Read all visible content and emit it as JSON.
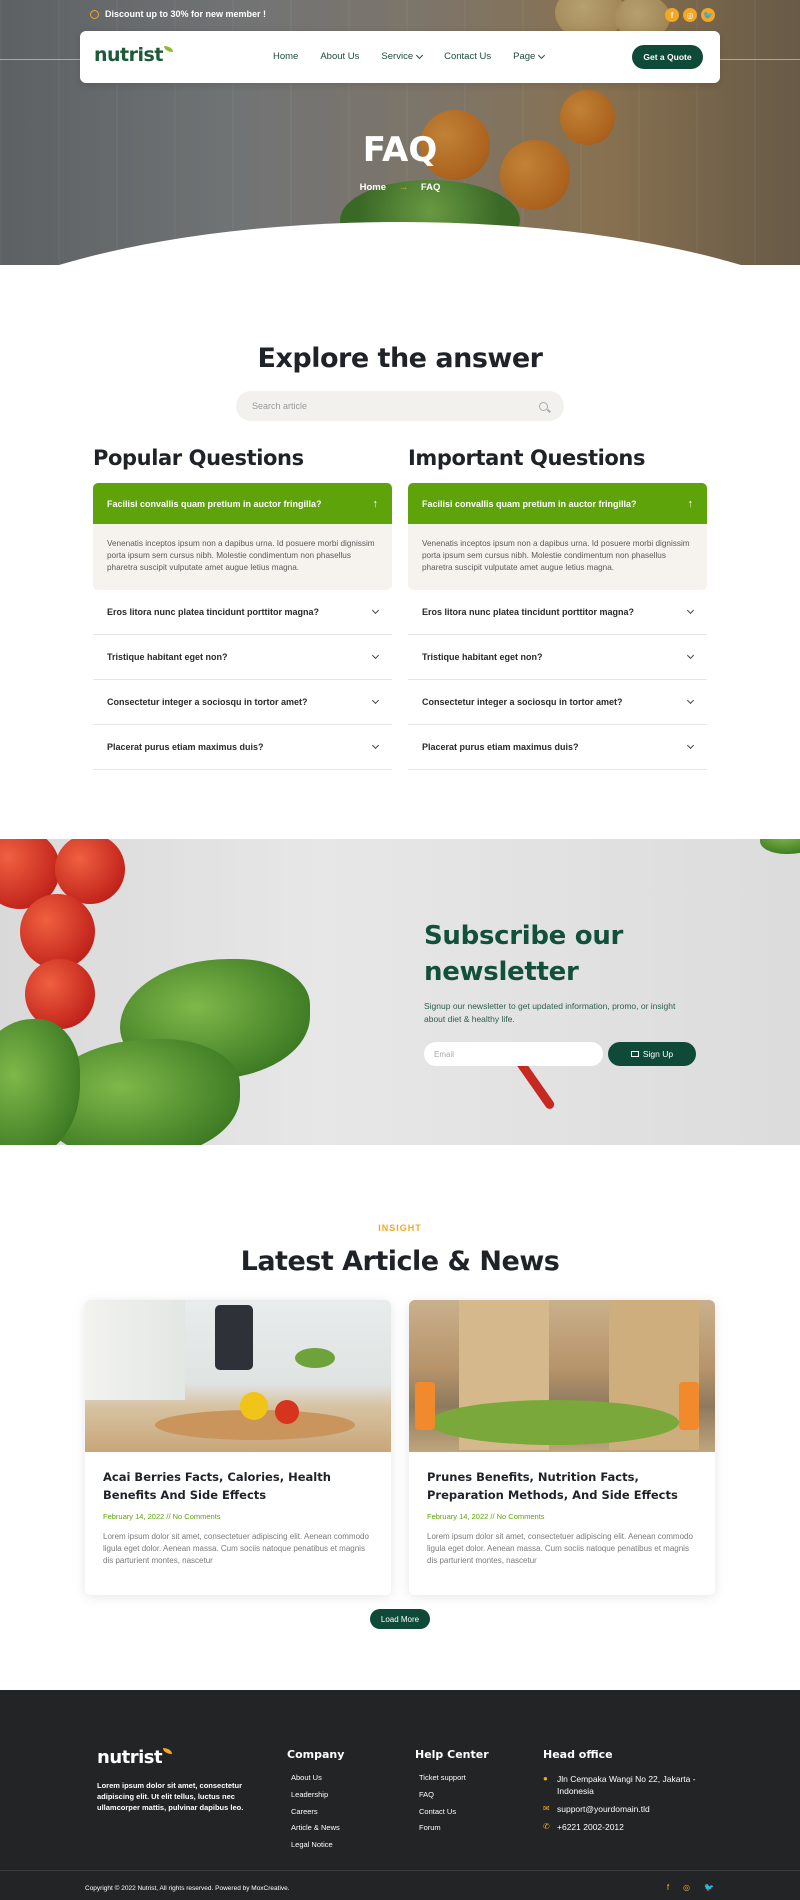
{
  "topbar": {
    "promo": "Discount up to 30% for new member !",
    "social": [
      "f",
      "◎",
      "🐦"
    ]
  },
  "nav": {
    "logo": "nutrist",
    "items": [
      {
        "label": "Home",
        "dropdown": false
      },
      {
        "label": "About Us",
        "dropdown": false
      },
      {
        "label": "Service",
        "dropdown": true
      },
      {
        "label": "Contact Us",
        "dropdown": false
      },
      {
        "label": "Page",
        "dropdown": true
      }
    ],
    "cta": "Get a Quote"
  },
  "hero": {
    "title": "FAQ",
    "breadcrumb_home": "Home",
    "breadcrumb_arrow": "→",
    "breadcrumb_current": "FAQ"
  },
  "faq": {
    "title": "Explore the answer",
    "search_placeholder": "Search article",
    "popular": {
      "heading": "Popular Questions",
      "active_question": "Facilisi convallis quam pretium in auctor fringilla?",
      "active_answer": "Venenatis inceptos ipsum non a dapibus urna. Id posuere morbi dignissim porta ipsum sem cursus nibh. Molestie condimentum non phasellus pharetra suscipit vulputate amet augue letius magna.",
      "questions": [
        "Eros litora nunc platea tincidunt porttitor magna?",
        "Tristique habitant eget non?",
        "Consectetur integer a sociosqu in tortor amet?",
        "Placerat purus etiam maximus duis?"
      ]
    },
    "important": {
      "heading": "Important Questions",
      "active_question": "Facilisi convallis quam pretium in auctor fringilla?",
      "active_answer": "Venenatis inceptos ipsum non a dapibus urna. Id posuere morbi dignissim porta ipsum sem cursus nibh. Molestie condimentum non phasellus pharetra suscipit vulputate amet augue letius magna.",
      "questions": [
        "Eros litora nunc platea tincidunt porttitor magna?",
        "Tristique habitant eget non?",
        "Consectetur integer a sociosqu in tortor amet?",
        "Placerat purus etiam maximus duis?"
      ]
    }
  },
  "newsletter": {
    "title": "Subscribe our newsletter",
    "subtitle": "Signup our newsletter to get updated information, promo, or insight about diet & healthy life.",
    "email_placeholder": "Email",
    "button": "Sign Up"
  },
  "articles": {
    "eyebrow": "INSIGHT",
    "title": "Latest Article & News",
    "items": [
      {
        "title": "Acai Berries Facts, Calories, Health Benefits And Side Effects",
        "meta": "February 14, 2022 // No Comments",
        "excerpt": "Lorem ipsum dolor sit amet, consectetuer adipiscing elit. Aenean commodo ligula eget dolor. Aenean massa. Cum sociis natoque penatibus et magnis dis parturient montes, nascetur"
      },
      {
        "title": "Prunes Benefits, Nutrition Facts, Preparation Methods, And Side Effects",
        "meta": "February 14, 2022 // No Comments",
        "excerpt": "Lorem ipsum dolor sit amet, consectetuer adipiscing elit. Aenean commodo ligula eget dolor. Aenean massa. Cum sociis natoque penatibus et magnis dis parturient montes, nascetur"
      }
    ],
    "load_more": "Load More"
  },
  "footer": {
    "logo": "nutrist",
    "description": "Lorem ipsum dolor sit amet, consectetur adipiscing elit. Ut elit tellus, luctus nec ullamcorper mattis, pulvinar dapibus leo.",
    "company": {
      "heading": "Company",
      "links": [
        "About Us",
        "Leadership",
        "Careers",
        "Article & News",
        "Legal Notice"
      ]
    },
    "help": {
      "heading": "Help Center",
      "links": [
        "Ticket support",
        "FAQ",
        "Contact Us",
        "Forum"
      ]
    },
    "office": {
      "heading": "Head office",
      "address": "Jln Cempaka Wangi No 22, Jakarta - Indonesia",
      "email": "support@yourdomain.tld",
      "phone": "+6221 2002-2012"
    },
    "copyright": "Copyright © 2022 Nutrist, All rights reserved. Powered by MoxCreative.",
    "social": [
      "f",
      "◎",
      "🐦"
    ]
  },
  "colors": {
    "primary_dark_green": "#0f4a38",
    "accent_green": "#5ea30a",
    "accent_orange": "#f5a623",
    "footer_bg": "#222425"
  }
}
